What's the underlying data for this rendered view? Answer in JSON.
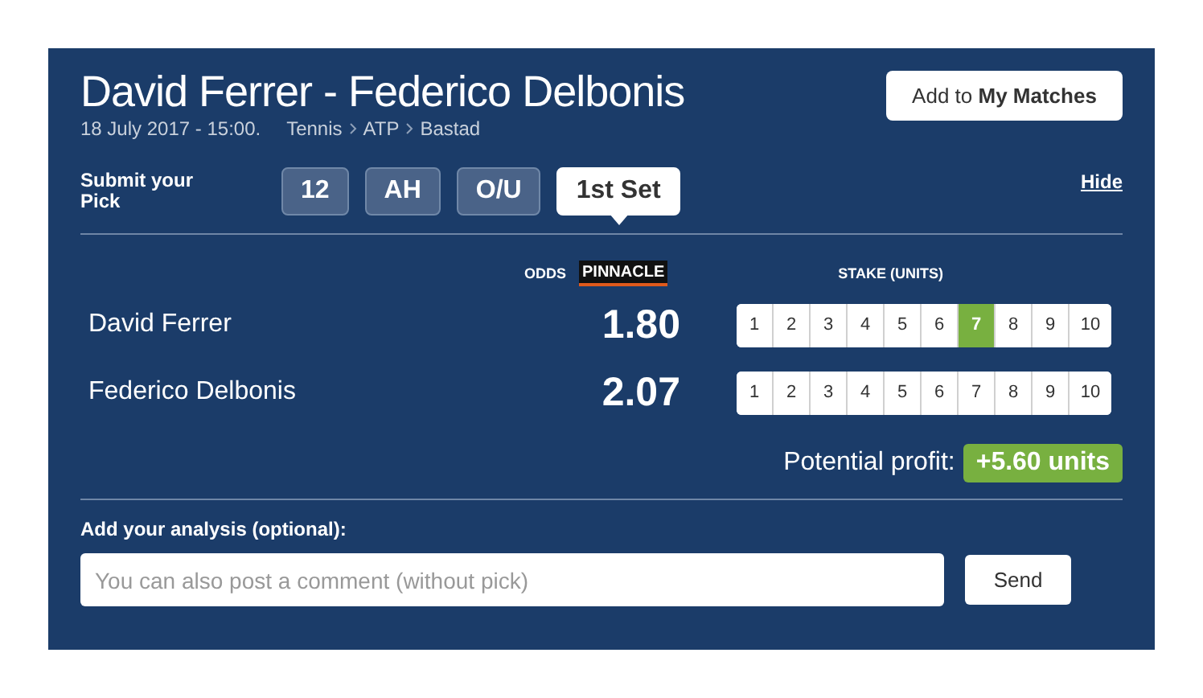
{
  "match": {
    "title": "David Ferrer - Federico Delbonis",
    "date": "18 July 2017 - 15:00.",
    "breadcrumb": [
      "Tennis",
      "ATP",
      "Bastad"
    ]
  },
  "add_button": {
    "label": "Add to **My Matches**"
  },
  "pick": {
    "label": "Submit your Pick",
    "hide_link": "Hide",
    "tabs": [
      {
        "label": "12",
        "selected": false
      },
      {
        "label": "AH",
        "selected": false
      },
      {
        "label": "O/U",
        "selected": false
      },
      {
        "label": "1st Set",
        "selected": true
      }
    ]
  },
  "odds_header": {
    "odds": "ODDS",
    "bookmaker": "PINNACLE",
    "stake": "STAKE (UNITS)"
  },
  "selections": [
    {
      "name": "David Ferrer",
      "odds": "1.80",
      "stakes": [
        {
          "label": "1",
          "selected": false
        },
        {
          "label": "2",
          "selected": false
        },
        {
          "label": "3",
          "selected": false
        },
        {
          "label": "4",
          "selected": false
        },
        {
          "label": "5",
          "selected": false
        },
        {
          "label": "6",
          "selected": false
        },
        {
          "label": "7",
          "selected": true
        },
        {
          "label": "8",
          "selected": false
        },
        {
          "label": "9",
          "selected": false
        },
        {
          "label": "10",
          "selected": false
        }
      ]
    },
    {
      "name": "Federico Delbonis",
      "odds": "2.07",
      "stakes": [
        {
          "label": "1",
          "selected": false
        },
        {
          "label": "2",
          "selected": false
        },
        {
          "label": "3",
          "selected": false
        },
        {
          "label": "4",
          "selected": false
        },
        {
          "label": "5",
          "selected": false
        },
        {
          "label": "6",
          "selected": false
        },
        {
          "label": "7",
          "selected": false
        },
        {
          "label": "8",
          "selected": false
        },
        {
          "label": "9",
          "selected": false
        },
        {
          "label": "10",
          "selected": false
        }
      ]
    }
  ],
  "profit": {
    "label": "Potential profit:",
    "value": "+5.60 units"
  },
  "analysis": {
    "label": "Add your analysis (optional):",
    "placeholder": "You can also post a comment (without pick)",
    "send": "Send"
  }
}
